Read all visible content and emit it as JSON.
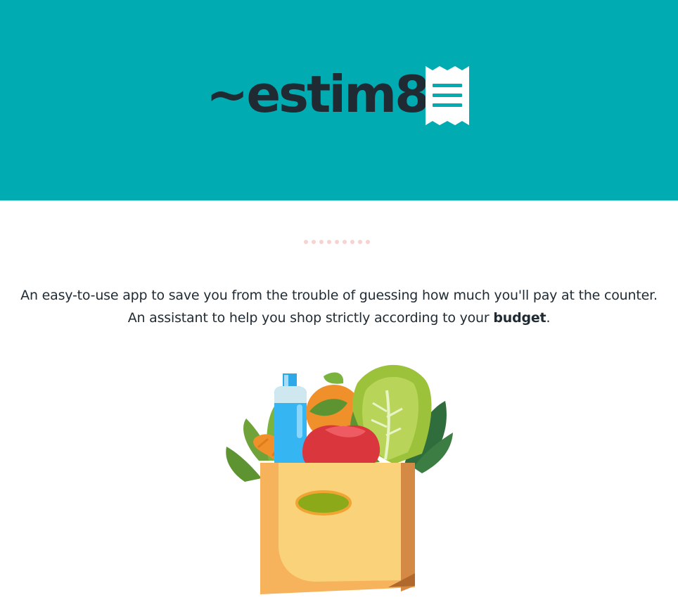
{
  "hero": {
    "background_color": "#00abb2",
    "logo_text": "~estim8",
    "logo_icon": "receipt-icon"
  },
  "divider": {
    "style": "dotted",
    "color": "#f6d3cf",
    "count": 9
  },
  "intro": {
    "line1": "An easy-to-use app to save you from the trouble of guessing how much you'll pay at the counter.",
    "line2_prefix": "An assistant to help you shop strictly according to your ",
    "line2_emphasis": "budget",
    "line2_suffix": "."
  },
  "illustration": {
    "icon": "grocery-bag-illustration"
  }
}
